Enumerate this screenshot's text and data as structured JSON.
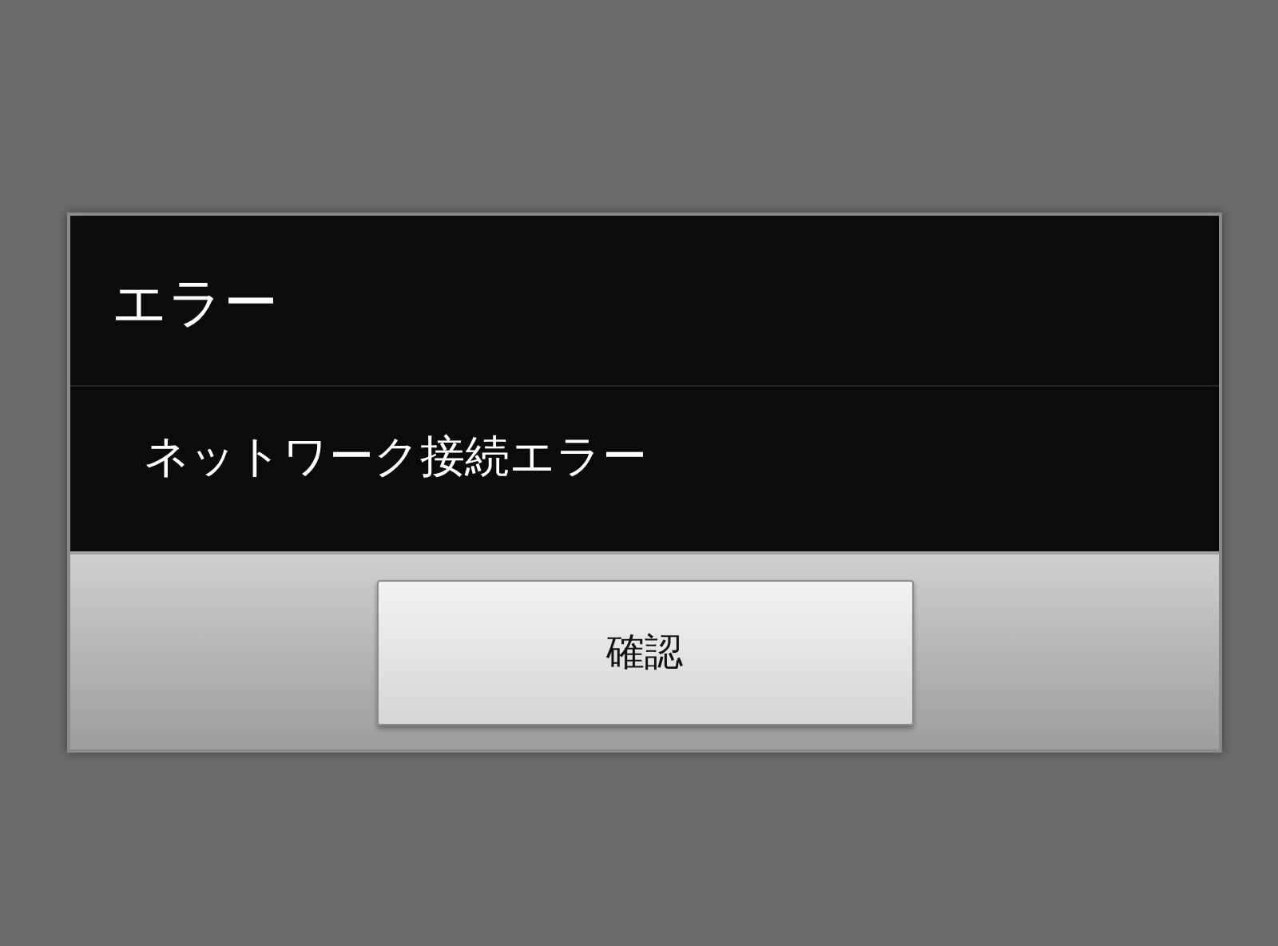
{
  "dialog": {
    "title": "エラー",
    "message": "ネットワーク接続エラー",
    "buttons": [
      "確認"
    ]
  }
}
